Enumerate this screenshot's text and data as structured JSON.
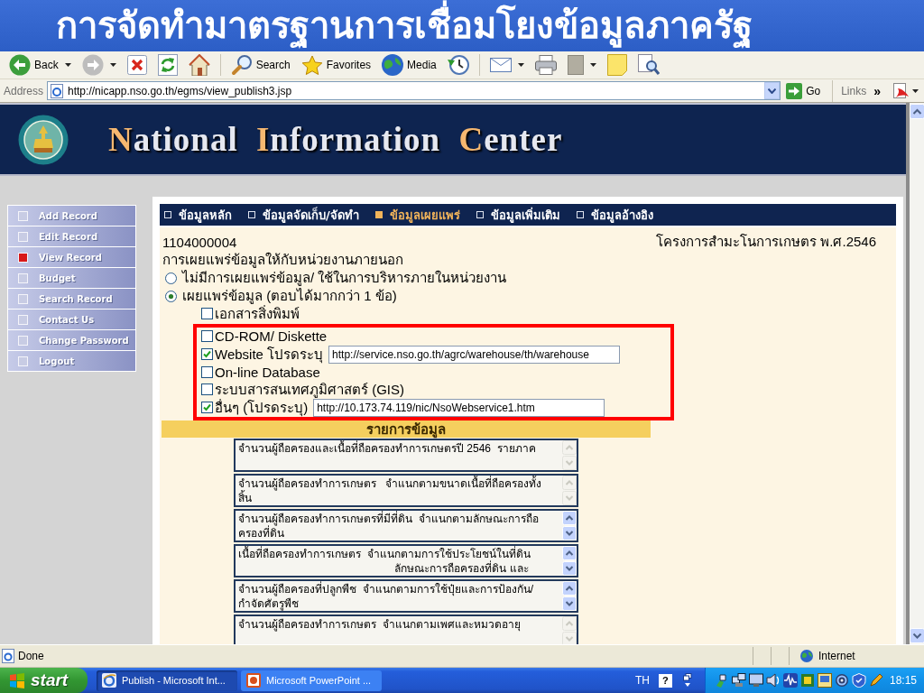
{
  "slide_title": "การจัดทำมาตรฐานการเชื่อมโยงข้อมูลภาครัฐ",
  "toolbar": [
    {
      "kind": "back",
      "label": "Back"
    },
    {
      "kind": "forward"
    },
    {
      "kind": "stop"
    },
    {
      "kind": "refresh"
    },
    {
      "kind": "home"
    },
    {
      "kind": "search",
      "label": "Search"
    },
    {
      "kind": "favorites",
      "label": "Favorites"
    },
    {
      "kind": "media",
      "label": "Media"
    },
    {
      "kind": "history"
    },
    {
      "kind": "mail"
    },
    {
      "kind": "print"
    },
    {
      "kind": "edit"
    },
    {
      "kind": "discuss"
    },
    {
      "kind": "research"
    }
  ],
  "address_bar": {
    "label": "Address",
    "url": "http://nicapp.nso.go.th/egms/view_publish3.jsp",
    "go": "Go",
    "links": "Links",
    "more": "»"
  },
  "page": {
    "site_title": "National Information Center",
    "menu": [
      {
        "label": "Add Record",
        "selected": false
      },
      {
        "label": "Edit Record",
        "selected": false
      },
      {
        "label": "View Record",
        "selected": true
      },
      {
        "label": "Budget",
        "selected": false
      },
      {
        "label": "Search Record",
        "selected": false
      },
      {
        "label": "Contact Us",
        "selected": false
      },
      {
        "label": "Change Password",
        "selected": false
      },
      {
        "label": "Logout",
        "selected": false
      }
    ],
    "tabs": [
      {
        "label": "ข้อมูลหลัก",
        "selected": false
      },
      {
        "label": "ข้อมูลจัดเก็บ/จัดทำ",
        "selected": false
      },
      {
        "label": "ข้อมูลเผยแพร่",
        "selected": true
      },
      {
        "label": "ข้อมูลเพิ่มเติม",
        "selected": false
      },
      {
        "label": "ข้อมูลอ้างอิง",
        "selected": false
      }
    ],
    "record_id": "1104000004",
    "project": "โครงการสำมะโนการเกษตร พ.ศ.2546",
    "question": "การเผยแพร่ข้อมูลให้กับหน่วยงานภายนอก",
    "choices": [
      {
        "label": "ไม่มีการเผยแพร่ข้อมูล/ ใช้ในการบริหารภายในหน่วยงาน",
        "selected": false
      },
      {
        "label": "เผยแพร่ข้อมูล (ตอบได้มากกว่า 1 ข้อ)",
        "selected": true
      }
    ],
    "options": [
      {
        "label": "เอกสารสิ่งพิมพ์",
        "checked": false,
        "highlighted": false
      },
      {
        "label": "CD-ROM/ Diskette",
        "checked": false,
        "highlighted": true
      },
      {
        "label": "Website โปรดระบุ",
        "checked": true,
        "highlighted": true,
        "value": "http://service.nso.go.th/agrc/warehouse/th/warehouse"
      },
      {
        "label": "On-line Database",
        "checked": false,
        "highlighted": true
      },
      {
        "label": "ระบบสารสนเทศภูมิศาสตร์ (GIS)",
        "checked": false,
        "highlighted": true
      },
      {
        "label": "อื่นๆ (โปรดระบุ)",
        "checked": true,
        "highlighted": true,
        "value": "http://10.173.74.119/nic/NsoWebservice1.htm"
      }
    ],
    "list_heading": "รายการข้อมูล",
    "datasets": [
      {
        "lines": [
          "จำนวนผู้ถือครองและเนื้อที่ถือครองทำการเกษตรปี 2546  รายภาค"
        ],
        "scrollable": false
      },
      {
        "lines": [
          "จำนวนผู้ถือครองทำการเกษตร   จำแนกตามขนาดเนื้อที่ถือครองทั้ง",
          "สิ้น"
        ],
        "scrollable": false
      },
      {
        "lines": [
          "จำนวนผู้ถือครองทำการเกษตรที่มีที่ดิน  จำแนกตามลักษณะการถือ",
          "ครองที่ดิน"
        ],
        "scrollable": true
      },
      {
        "lines": [
          "เนื้อที่ถือครองทำการเกษตร  จำแนกตามการใช้ประโยชน์ในที่ดิน",
          "                                                    ลักษณะการถือครองที่ดิน และ"
        ],
        "scrollable": true
      },
      {
        "lines": [
          "จำนวนผู้ถือครองที่ปลูกพืช  จำแนกตามการใช้ปุ๋ยและการป้องกัน/",
          "กำจัดศัตรูพืช"
        ],
        "scrollable": true
      },
      {
        "lines": [
          "จำนวนผู้ถือครองทำการเกษตร  จำแนกตามเพศและหมวดอายุ"
        ],
        "scrollable": false
      }
    ]
  },
  "status_bar": {
    "text": "Done",
    "zone": "Internet"
  },
  "taskbar": {
    "start": "start",
    "tasks": [
      {
        "kind": "browser",
        "label": "Publish - Microsoft Int...",
        "selected": true
      },
      {
        "kind": "presentation",
        "label": "Microsoft PowerPoint ...",
        "selected": false
      }
    ],
    "language": "TH",
    "help": "?",
    "clock": "18:15"
  }
}
